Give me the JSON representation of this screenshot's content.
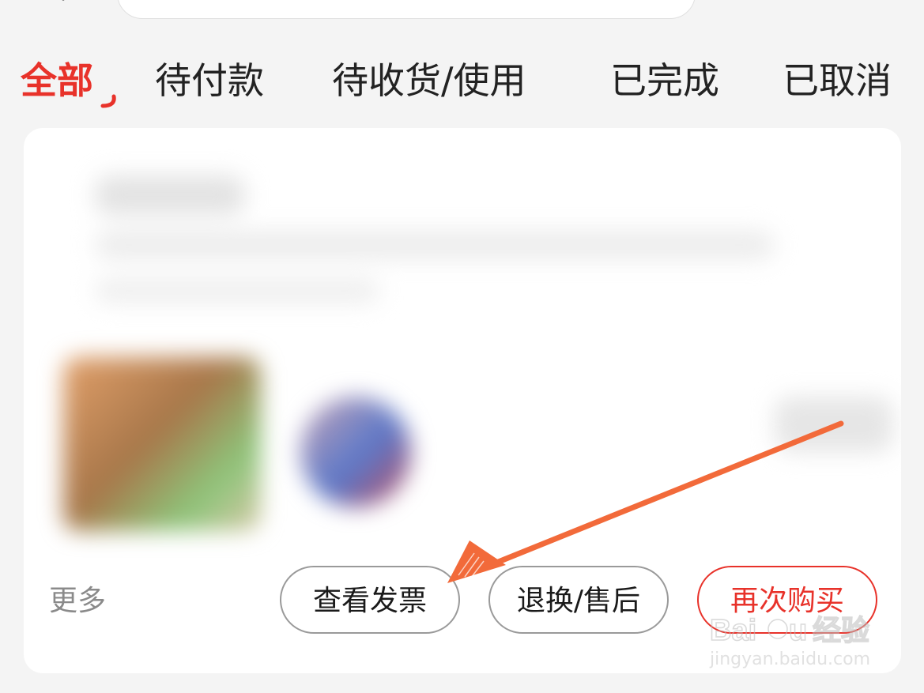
{
  "tabs": [
    {
      "label": "全部",
      "active": true
    },
    {
      "label": "待付款",
      "active": false
    },
    {
      "label": "待收货/使用",
      "active": false
    },
    {
      "label": "已完成",
      "active": false
    },
    {
      "label": "已取消",
      "active": false
    }
  ],
  "order_card": {
    "more_label": "更多",
    "buttons": {
      "view_invoice": "查看发票",
      "return_exchange": "退换/售后",
      "buy_again": "再次购买"
    }
  },
  "watermark": {
    "brand": "Baidu经验",
    "url": "jingyan.baidu.com"
  },
  "colors": {
    "accent": "#e8322a",
    "annotation_arrow": "#f26a3a",
    "background": "#f4f4f4",
    "card": "#ffffff"
  },
  "icons": {
    "back": "chevron-left-icon",
    "tab_indicator": "tab-active-hook-icon",
    "annotation": "arrow-annotation-icon"
  }
}
